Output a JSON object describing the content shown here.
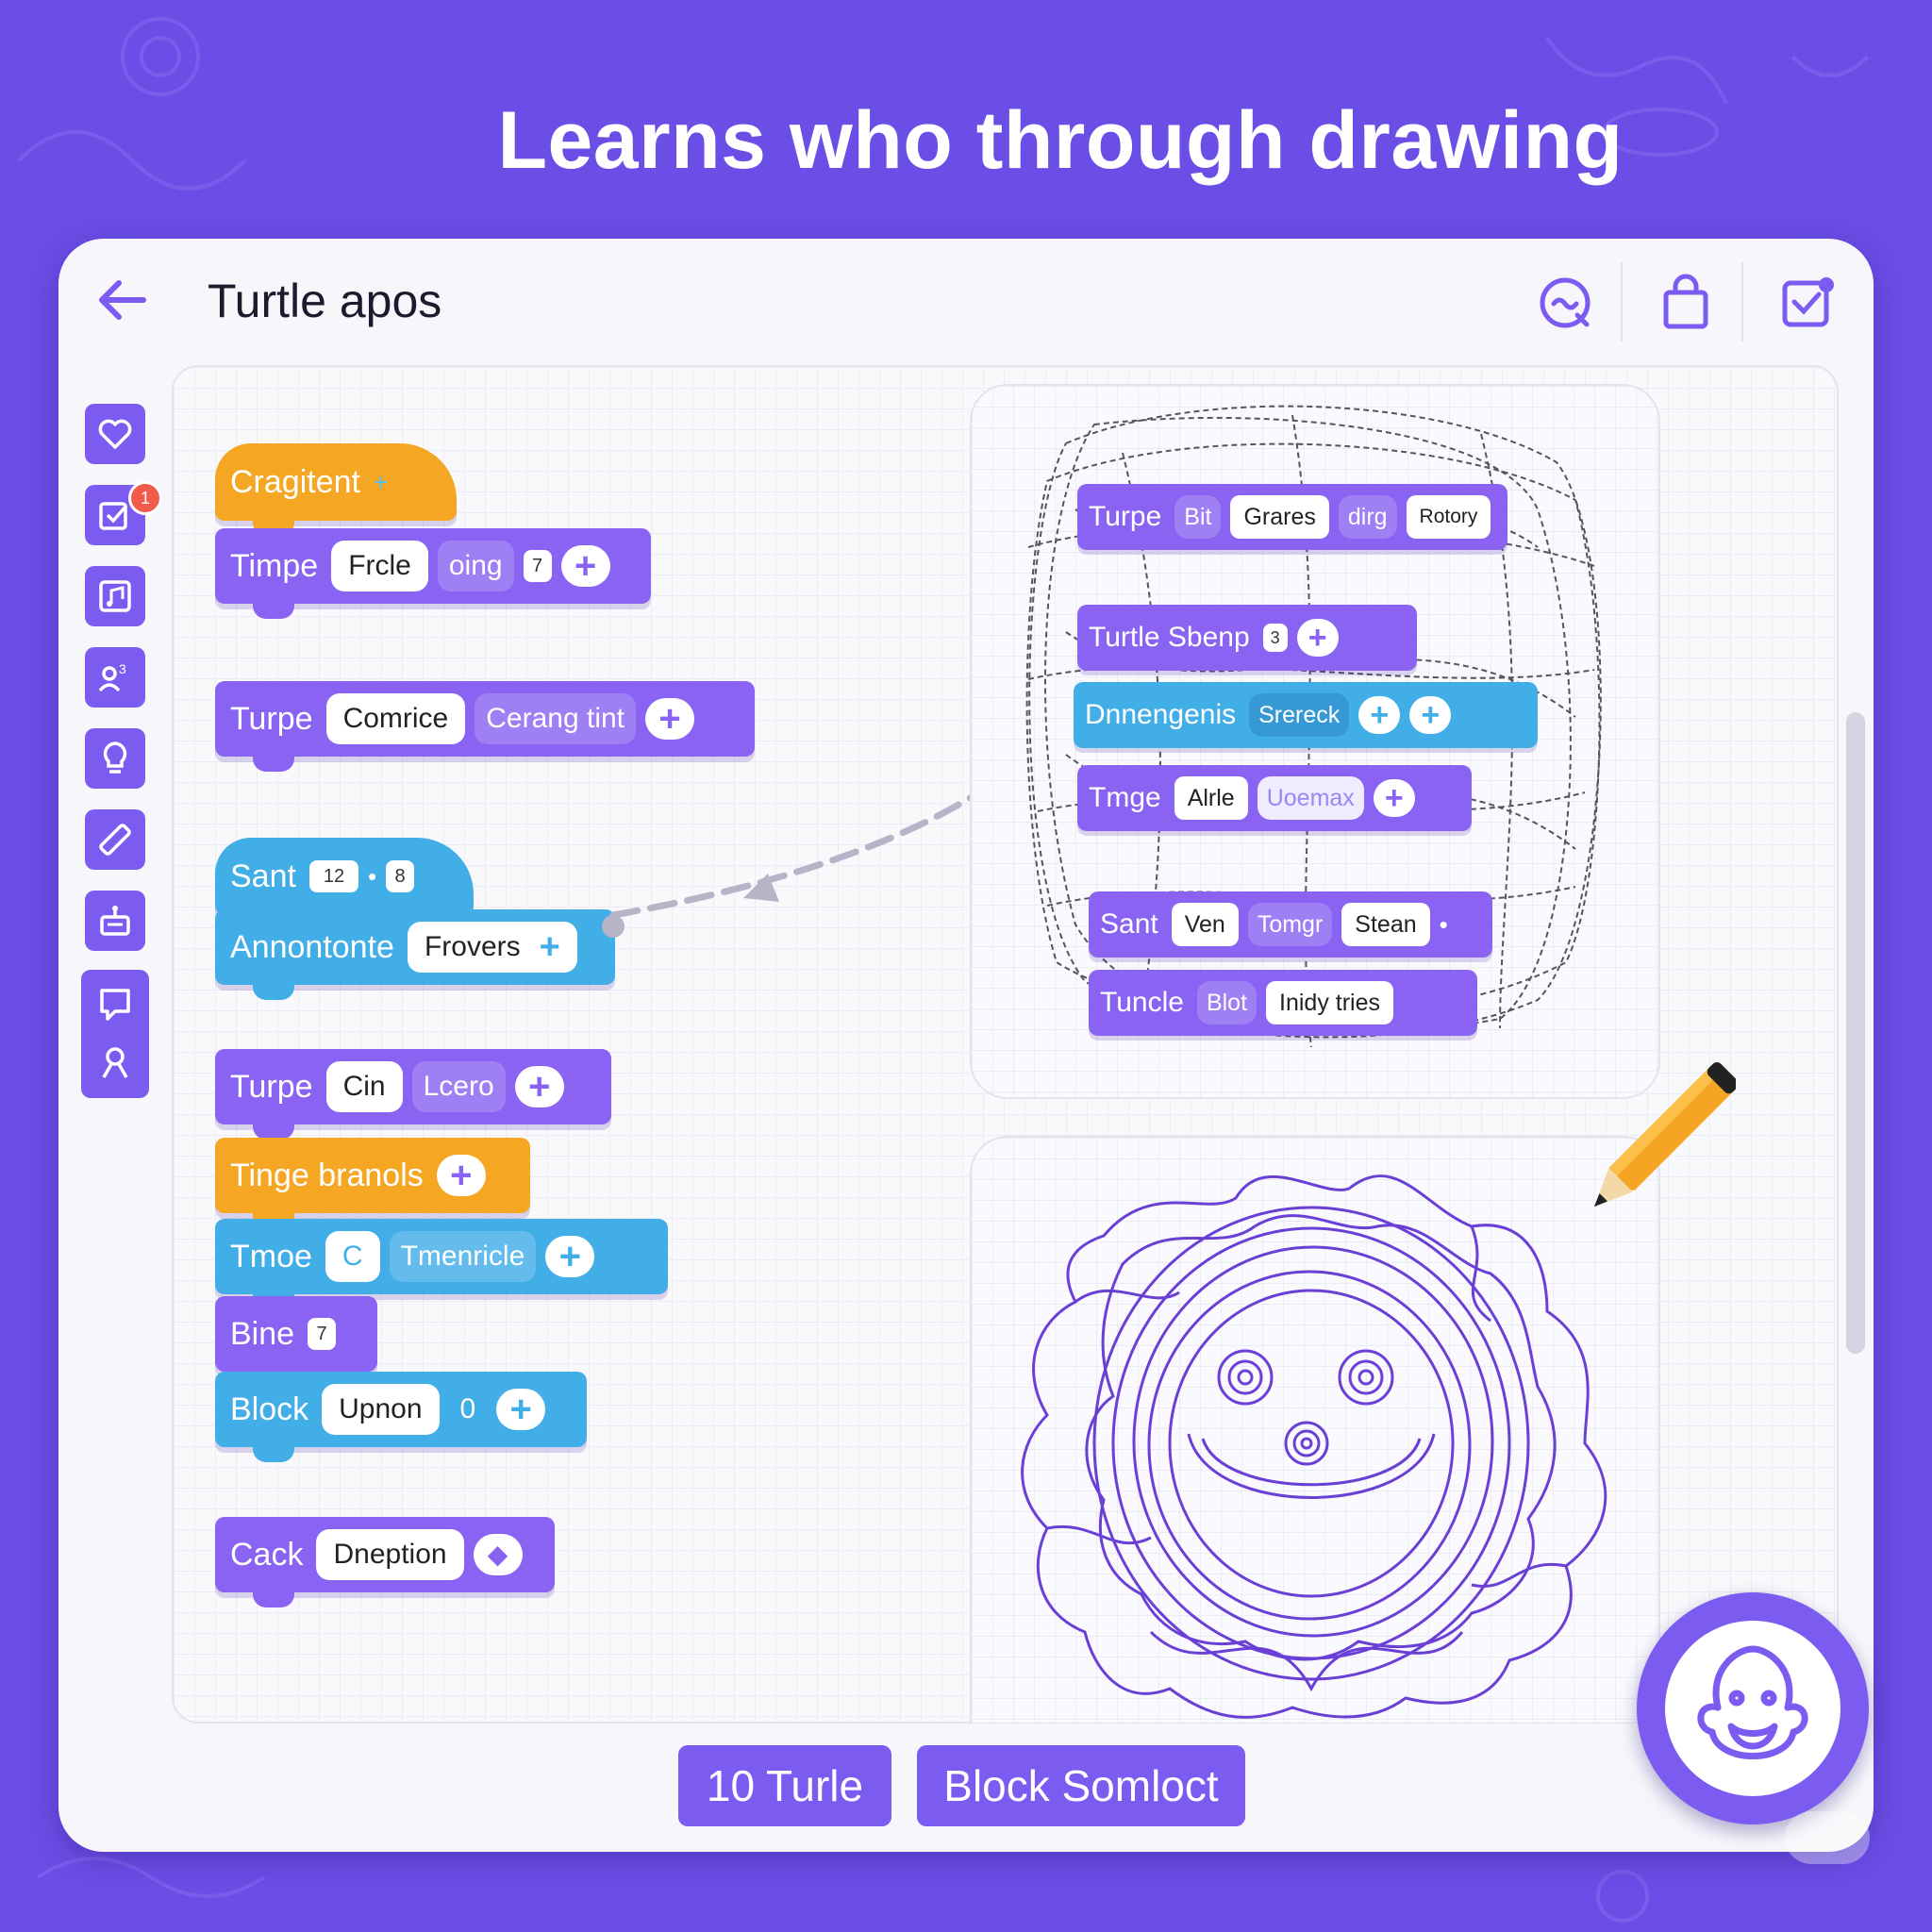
{
  "headline": "Learns who through drawing",
  "app": {
    "title": "Turtle apos",
    "icons": [
      "back-arrow-icon",
      "search-chat-icon",
      "shopping-bag-icon",
      "download-box-icon"
    ]
  },
  "sidebar": {
    "items": [
      {
        "icon": "heart-icon"
      },
      {
        "icon": "checkbox-icon",
        "badge": "1"
      },
      {
        "icon": "music-icon"
      },
      {
        "icon": "people-icon"
      },
      {
        "icon": "lightbulb-icon"
      },
      {
        "icon": "ruler-icon"
      },
      {
        "icon": "robot-icon"
      },
      {
        "icon": "frame-icon"
      },
      {
        "icon": "character-icon"
      }
    ]
  },
  "left_blocks": [
    {
      "label": "Cragitent",
      "extra": "+"
    },
    {
      "label": "Timpe",
      "pill": "Frcle",
      "ghost": "oing",
      "mini": "7"
    },
    {
      "label": "Turpe",
      "pill": "Comrice",
      "ghost": "Cerang tint"
    },
    {
      "label": "Sant",
      "pill": "12",
      "mini": "8"
    },
    {
      "label": "Annontonte",
      "pill": "Frovers"
    },
    {
      "label": "Turpe",
      "pill": "Cin",
      "ghost": "Lcero"
    },
    {
      "label": "Tinge branols"
    },
    {
      "label": "Tmoe",
      "pill": "C",
      "ghost": "Tmenricle"
    },
    {
      "label": "Bine",
      "mini": "7"
    },
    {
      "label": "Block",
      "pill": "Upnon",
      "ghost": "0"
    },
    {
      "label": "Cack",
      "pill": "Dneption"
    }
  ],
  "right_blocks": [
    {
      "label": "Turpe",
      "ghost1": "Bit",
      "pill": "Grares",
      "ghost2": "dirg",
      "pill2": "Rotory"
    },
    {
      "label": "Turtle Sbenp",
      "mini": "3"
    },
    {
      "label": "Dnnengenis",
      "ghost": "Srereck"
    },
    {
      "label": "Tmge",
      "pill": "Alrle",
      "ghost": "Uoemax"
    },
    {
      "label": "Sant",
      "pill": "Ven",
      "ghost": "Tomgr",
      "pill2": "Stean"
    },
    {
      "label": "Tuncle",
      "ghost": "Blot",
      "pill": "Inidy tries"
    }
  ],
  "bottom_buttons": [
    "10 Turle",
    "Block Somloct"
  ],
  "colors": {
    "accent": "#7c5cf0",
    "block_purple": "#8a63f2",
    "block_blue": "#42aee8",
    "block_orange": "#f5a623",
    "drawing": "#6a3fd6"
  }
}
